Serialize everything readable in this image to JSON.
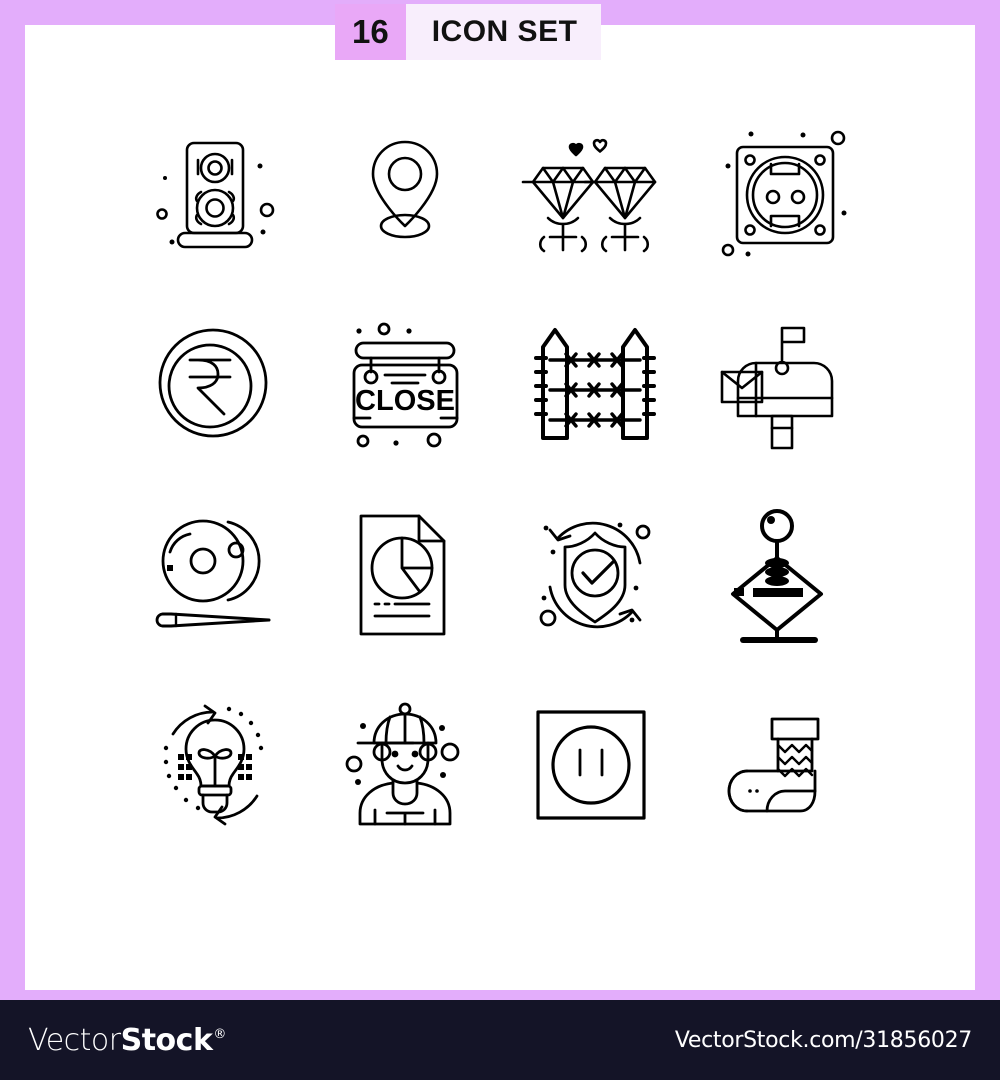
{
  "header": {
    "count": "16",
    "title": "ICON SET",
    "badge_color": "#E9A8F7",
    "plate_color": "#F8EEFC"
  },
  "frame": {
    "border_color": "#E3ADFB",
    "canvas_color": "#FFFFFF"
  },
  "icons": [
    {
      "name": "speaker-icon",
      "label": "Speaker"
    },
    {
      "name": "location-pin-icon",
      "label": "Location Pin"
    },
    {
      "name": "diamond-rings-icon",
      "label": "Diamond Rings"
    },
    {
      "name": "power-socket-icon",
      "label": "Power Socket"
    },
    {
      "name": "rupee-coin-icon",
      "label": "Rupee Coin"
    },
    {
      "name": "close-sign-icon",
      "label": "Close Sign",
      "sign_text": "CLOSE"
    },
    {
      "name": "barbed-wire-fence-icon",
      "label": "Barbed Wire Fence"
    },
    {
      "name": "mailbox-icon",
      "label": "Mailbox"
    },
    {
      "name": "cymbals-icon",
      "label": "Cymbals"
    },
    {
      "name": "pie-chart-document-icon",
      "label": "Pie Chart Document"
    },
    {
      "name": "shield-check-icon",
      "label": "Shield Check"
    },
    {
      "name": "joystick-icon",
      "label": "Joystick"
    },
    {
      "name": "eco-bulb-icon",
      "label": "Eco Light Bulb"
    },
    {
      "name": "boy-with-cap-icon",
      "label": "Boy With Cap"
    },
    {
      "name": "square-outlet-icon",
      "label": "Square Outlet"
    },
    {
      "name": "christmas-stocking-icon",
      "label": "Christmas Stocking"
    }
  ],
  "footer": {
    "brand_prefix": "Vector",
    "brand_suffix": "Stock",
    "registered_mark": "®",
    "url": "VectorStock.com/31856027",
    "background": "#141427"
  }
}
